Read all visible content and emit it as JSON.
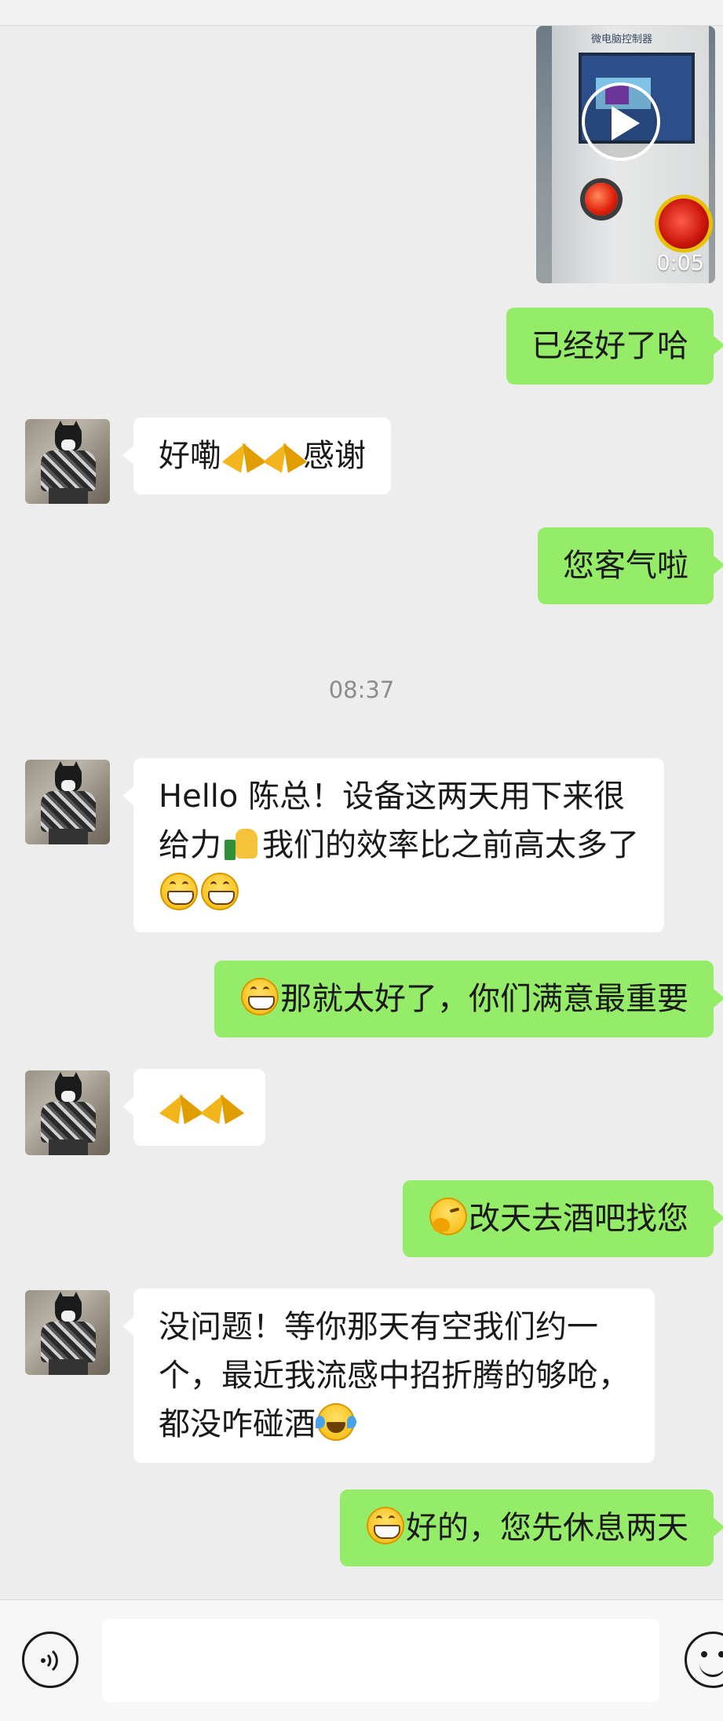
{
  "video": {
    "duration": "0:05",
    "screen_caption": "微电脑控制器"
  },
  "messages": [
    {
      "side": "right",
      "text": "已经好了哈"
    },
    {
      "side": "left",
      "text": "好嘞🙏🙏感谢"
    },
    {
      "side": "right",
      "text": "您客气啦"
    },
    {
      "side": "left",
      "lines": [
        "Hello 陈总！设备这两天用下来很",
        "给力👍我们的效率比之前高太多了",
        "😁😁"
      ]
    },
    {
      "side": "right",
      "text": "😁那就太好了，你们满意最重要"
    },
    {
      "side": "left",
      "text": "🙏🙏"
    },
    {
      "side": "right",
      "text": "🤭改天去酒吧找您"
    },
    {
      "side": "left",
      "lines": [
        "没问题！等你那天有空我们约一",
        "个，最近我流感中招折腾的够呛，",
        "都没咋碰酒😂"
      ]
    },
    {
      "side": "right",
      "text": "😁好的，您先休息两天"
    }
  ],
  "timestamp": "08:37",
  "text": {
    "m1": "已经好了哈",
    "m2a": "好嘞",
    "m2b": "感谢",
    "m3": "您客气啦",
    "m4_l1": "Hello 陈总！设备这两天用下来很",
    "m4_l2a": "给力",
    "m4_l2b": "我们的效率比之前高太多了",
    "m5": "那就太好了，你们满意最重要",
    "m7": "改天去酒吧找您",
    "m8_l1": "没问题！等你那天有空我们约一",
    "m8_l2": "个，最近我流感中招折腾的够呛，",
    "m8_l3": "都没咋碰酒",
    "m9": "好的，您先休息两天"
  },
  "icons": {
    "voice": "voice-icon",
    "emoji": "emoji-icon",
    "play": "play-icon"
  },
  "colors": {
    "background": "#ededed",
    "bubble_self": "#95ec69",
    "bubble_other": "#ffffff",
    "timestamp": "#8c8c8c"
  }
}
